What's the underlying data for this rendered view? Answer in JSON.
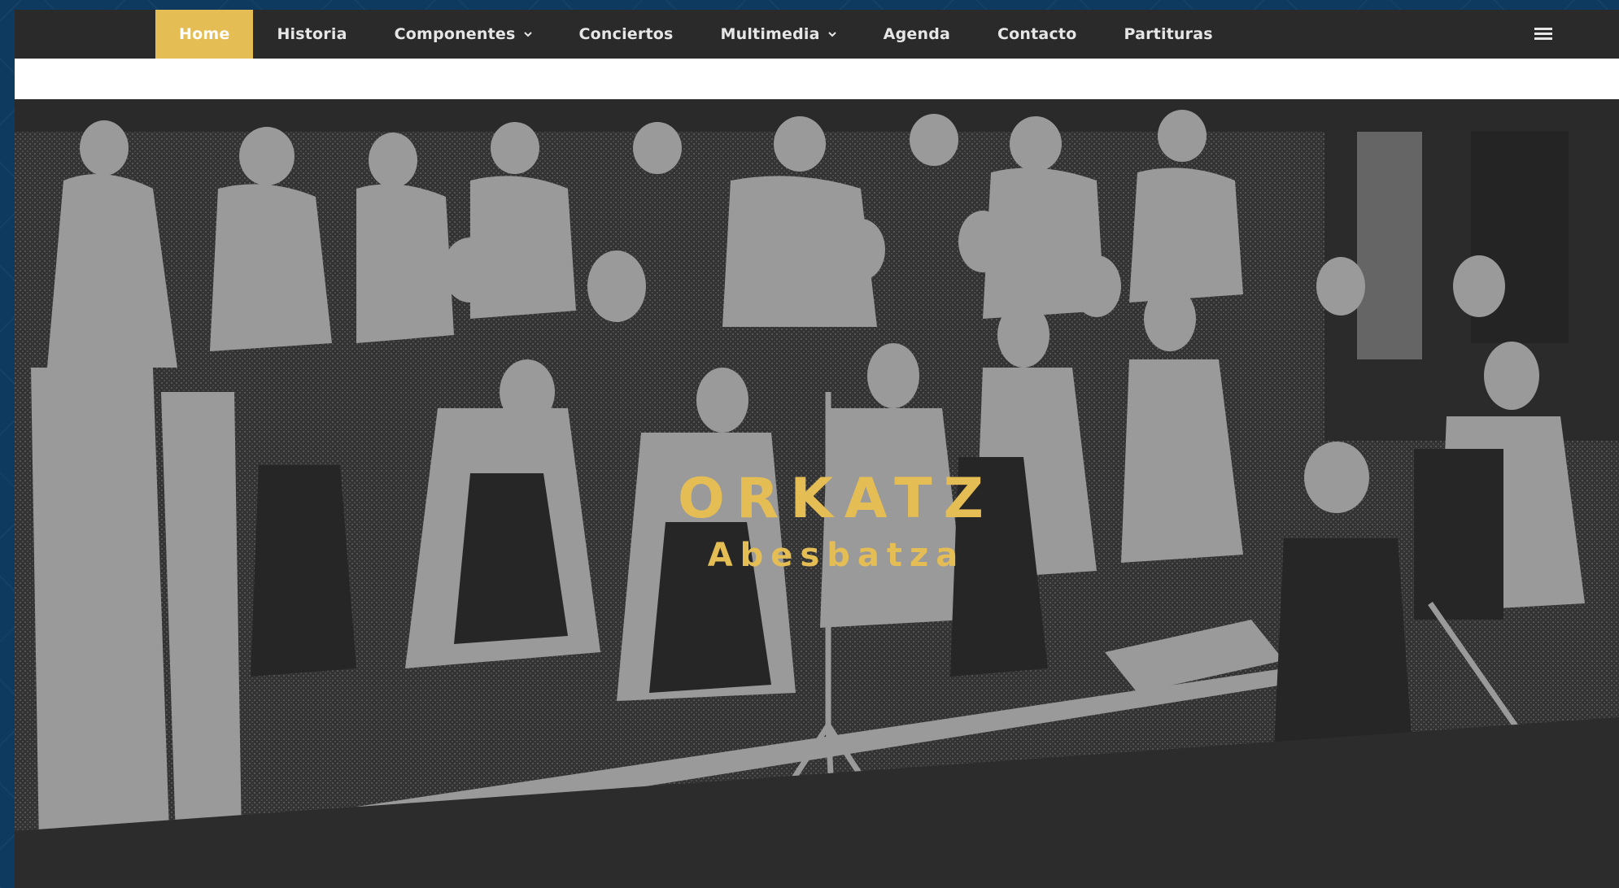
{
  "nav": {
    "items": [
      {
        "label": "Home",
        "active": true,
        "dropdown": false
      },
      {
        "label": "Historia",
        "active": false,
        "dropdown": false
      },
      {
        "label": "Componentes",
        "active": false,
        "dropdown": true
      },
      {
        "label": "Conciertos",
        "active": false,
        "dropdown": false
      },
      {
        "label": "Multimedia",
        "active": false,
        "dropdown": true
      },
      {
        "label": "Agenda",
        "active": false,
        "dropdown": false
      },
      {
        "label": "Contacto",
        "active": false,
        "dropdown": false
      },
      {
        "label": "Partituras",
        "active": false,
        "dropdown": false
      }
    ],
    "menu_icon": "hamburger-menu-icon"
  },
  "hero": {
    "title": "ORKATZ",
    "subtitle": "Abesbatza",
    "image": "choir-photo-posterized"
  },
  "colors": {
    "accent": "#e4bd55",
    "navbar": "#2a2a2a",
    "frame": "#0e3a5f",
    "photo_light": "#9a9a9a",
    "photo_dark": "#2f2f2f"
  }
}
